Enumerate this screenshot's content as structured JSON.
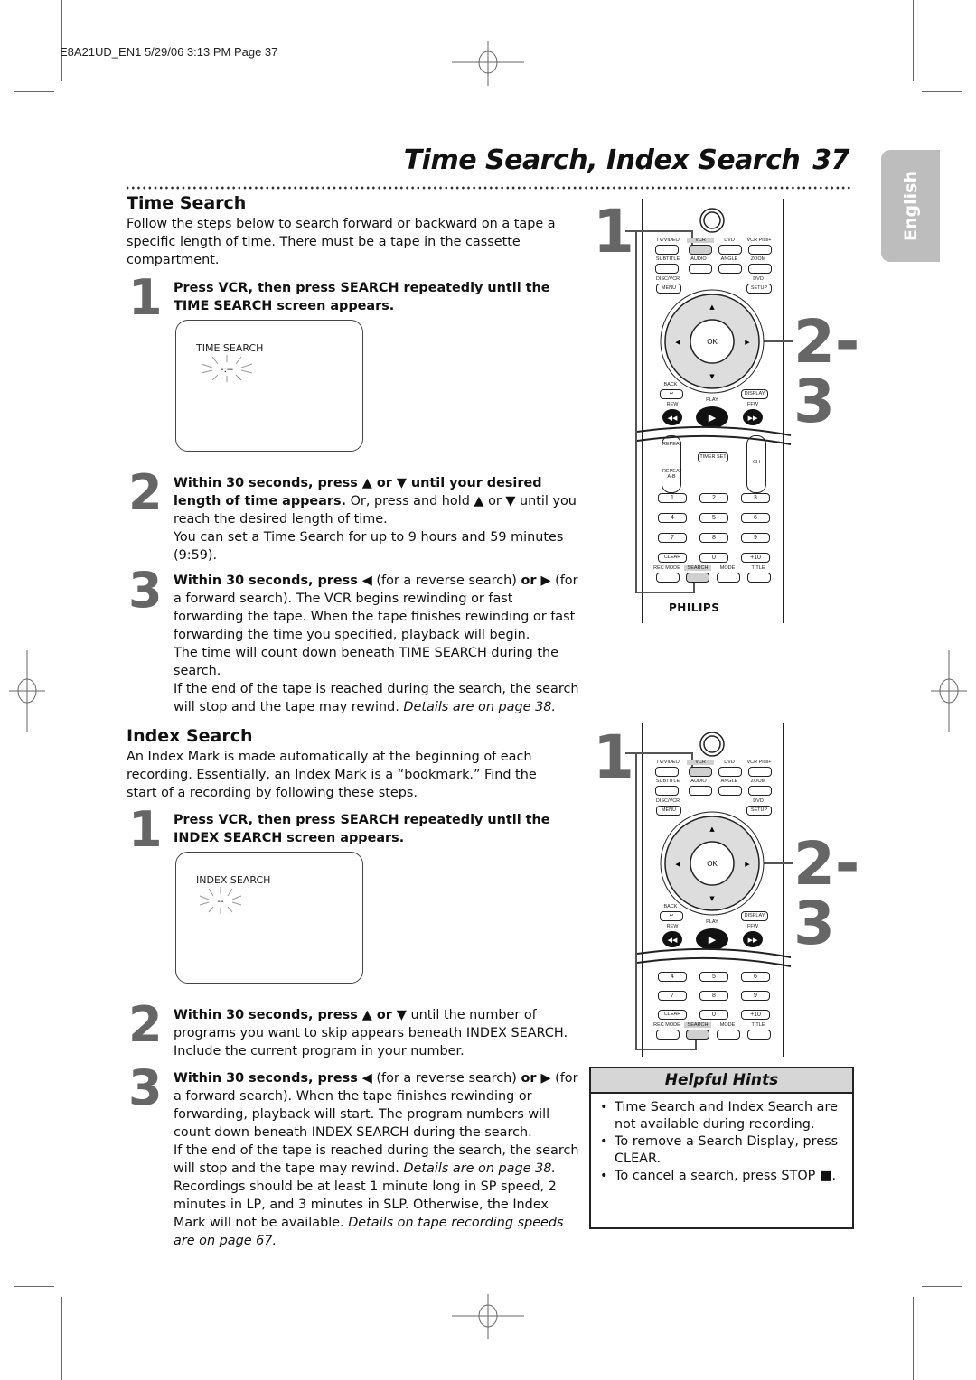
{
  "slug": "E8A21UD_EN1  5/29/06  3:13 PM  Page 37",
  "page_title": "Time Search, Index Search",
  "page_number": "37",
  "language_tab": "English",
  "time_search": {
    "heading": "Time Search",
    "intro": "Follow the steps below to search forward or backward on a tape a specific length of time. There must be a tape in the cassette compartment.",
    "steps": [
      {
        "num": "1",
        "bold": "Press VCR, then press SEARCH repeatedly until the TIME SEARCH screen appears.",
        "text": ""
      },
      {
        "num": "2",
        "bold": "Within 30 seconds, press ▲ or ▼ until your desired length of time appears.",
        "text": " Or, press and hold ▲ or ▼ until you reach the desired length of time.",
        "note": "You can set a Time Search for up to 9 hours and 59 minutes (9:59)."
      },
      {
        "num": "3",
        "bold_a": "Within 30 seconds, press ◀",
        "text_a": " (for a reverse search) ",
        "bold_b": "or ▶",
        "text_b": " (for a forward search). The VCR begins rewinding or fast forwarding the tape. When the tape finishes rewinding or fast forwarding the time you specified, playback will begin.",
        "note1": "The time will count down beneath TIME SEARCH during the search.",
        "note2": "If the end of the tape is reached during the search, the search will stop and the tape may rewind. ",
        "note2_italic": "Details are on page 38."
      }
    ],
    "screen_label": "TIME SEARCH",
    "screen_value": "-:--"
  },
  "index_search": {
    "heading": "Index Search",
    "intro": "An Index Mark is made automatically at the beginning of each recording. Essentially, an Index Mark is a “bookmark.” Find the start of a recording by following these steps.",
    "steps": [
      {
        "num": "1",
        "bold": "Press VCR, then press SEARCH repeatedly until the INDEX SEARCH screen appears."
      },
      {
        "num": "2",
        "bold": "Within 30 seconds, press ▲ or ▼",
        "text": " until the number of programs you want to skip appears beneath INDEX SEARCH. Include the current program in your number."
      },
      {
        "num": "3",
        "bold_a": "Within 30 seconds, press ◀",
        "text_a": " (for a reverse search) ",
        "bold_b": "or ▶",
        "text_b": " (for a forward search). When the tape finishes rewinding or forwarding, playback will start. The program numbers will count down beneath INDEX SEARCH during the search.",
        "note1": "If the end of the tape is reached during the search, the search will stop and the tape may rewind. ",
        "note1_italic": "Details are on page 38.",
        "note2": "Recordings should be at least 1 minute long in SP speed, 2 minutes in LP, and 3 minutes in SLP. Otherwise, the Index Mark will not be available. ",
        "note2_italic": "Details on tape recording speeds are on page 67."
      }
    ],
    "screen_label": "INDEX SEARCH",
    "screen_value": "--"
  },
  "remote": {
    "callout_1": "1",
    "callout_23": "2-3",
    "buttons_row1": [
      "TV/VIDEO",
      "VCR",
      "DVD",
      "VCR Plus+"
    ],
    "buttons_row2": [
      "SUBTITLE",
      "AUDIO",
      "ANGLE",
      "ZOOM"
    ],
    "menu_top": "DISC/VCR",
    "menu": "MENU",
    "setup_top": "DVD",
    "setup": "SETUP",
    "ok": "OK",
    "back": "BACK",
    "display": "DISPLAY",
    "rew": "REW",
    "play": "PLAY",
    "ffw": "FFW",
    "repeat": "REPEAT",
    "repeat_ab": "REPEAT A-B",
    "timer_set": "TIMER SET",
    "ch": "CH",
    "digits": [
      "1",
      "2",
      "3",
      "4",
      "5",
      "6",
      "7",
      "8",
      "9"
    ],
    "clear": "CLEAR",
    "zero": "0",
    "plus10": "+10",
    "bottom_row": [
      "REC MODE",
      "SEARCH",
      "MODE",
      "TITLE"
    ],
    "brand": "PHILIPS"
  },
  "hints": {
    "title": "Helpful Hints",
    "items": [
      "Time Search and Index Search are not available during recording.",
      "To remove a Search Display, press CLEAR.",
      "To cancel a search, press STOP ■."
    ]
  },
  "colors": {
    "accent_gray": "#666666",
    "tab_gray": "#bdbdbd",
    "highlight": "#d0d0d0"
  }
}
